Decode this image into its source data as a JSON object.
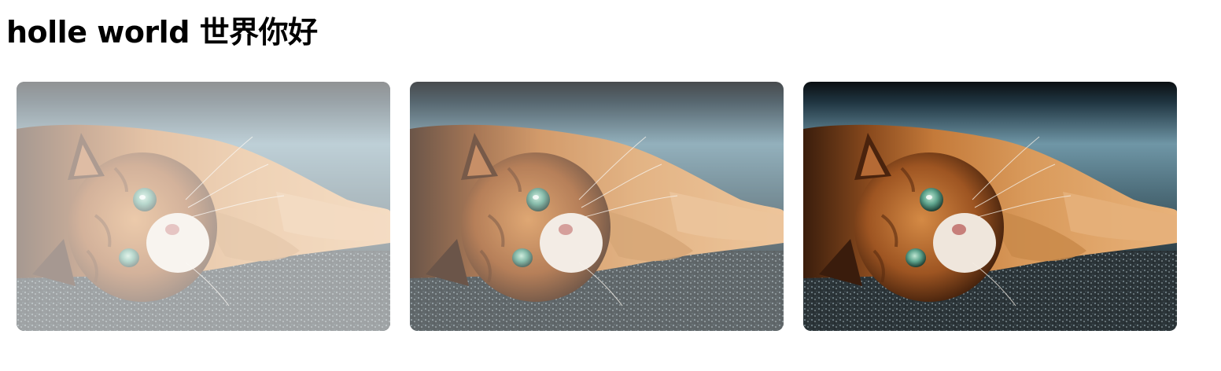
{
  "header": {
    "title": "holle world 世界你好"
  },
  "gallery": {
    "subject": "cat-photo",
    "cards": [
      {
        "name": "cat-image-faded",
        "opacity": 0.55
      },
      {
        "name": "cat-image-semi",
        "opacity": 0.25
      },
      {
        "name": "cat-image-full",
        "opacity": 0
      }
    ]
  }
}
